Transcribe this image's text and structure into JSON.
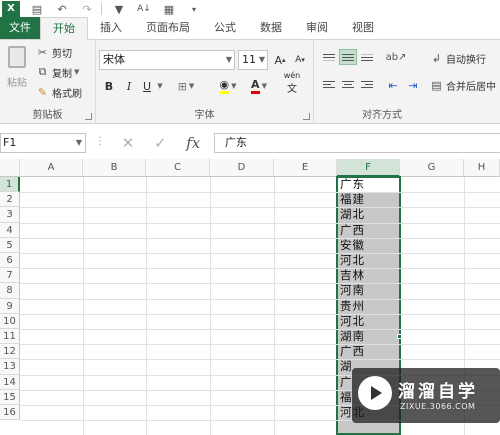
{
  "colors": {
    "accent": "#217346",
    "selection_fill": "#c8c8c8",
    "header_highlight": "#d3e3d8"
  },
  "qat": {
    "logo": "X",
    "buttons": [
      "save-icon",
      "undo-icon",
      "redo-icon",
      "filter-icon",
      "sort-icon",
      "form-icon"
    ]
  },
  "tabs": [
    "文件",
    "开始",
    "插入",
    "页面布局",
    "公式",
    "数据",
    "审阅",
    "视图"
  ],
  "ribbon": {
    "clipboard": {
      "paste_label": "粘贴",
      "cut": "剪切",
      "copy": "复制",
      "format_painter": "格式刷",
      "group_label": "剪贴板"
    },
    "font": {
      "font_name": "宋体",
      "font_size": "11",
      "group_label": "字体",
      "bold": "B",
      "italic": "I",
      "underline": "U",
      "grow": "A",
      "shrink": "A",
      "font_color": "A",
      "wen": "wén"
    },
    "alignment": {
      "wrap_text": "自动换行",
      "merge_center": "合并后居中",
      "group_label": "对齐方式"
    }
  },
  "formula_bar": {
    "name_box": "F1",
    "fx": "fx",
    "content": "广东"
  },
  "columns": [
    "A",
    "B",
    "C",
    "D",
    "E",
    "F",
    "G",
    "H"
  ],
  "rows": [
    "1",
    "2",
    "3",
    "4",
    "5",
    "6",
    "7",
    "8",
    "9",
    "10",
    "11",
    "12",
    "13",
    "14",
    "15",
    "16"
  ],
  "column_f": [
    "广东",
    "福建",
    "湖北",
    "广西",
    "安徽",
    "河北",
    "吉林",
    "河南",
    "贵州",
    "河北",
    "湖南",
    "广西",
    "湖",
    "广",
    "福",
    "河北"
  ],
  "watermark": {
    "title": "溜溜自学",
    "url": "ZIXUE.3066.COM"
  }
}
